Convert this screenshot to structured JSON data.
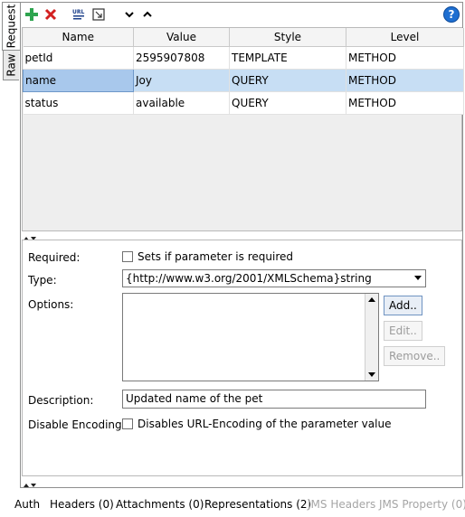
{
  "left_tabs": [
    {
      "label": "Request"
    },
    {
      "label": "Raw"
    }
  ],
  "toolbar": {
    "icons": [
      "add-icon",
      "delete-icon",
      "extract-url-params-icon",
      "fit-icon",
      "move-down-icon",
      "move-up-icon",
      "help-icon"
    ],
    "help_label": "?"
  },
  "table": {
    "headers": [
      "Name",
      "Value",
      "Style",
      "Level"
    ],
    "rows": [
      {
        "name": "petId",
        "value": "2595907808",
        "style": "TEMPLATE",
        "level": "METHOD",
        "selected": false
      },
      {
        "name": "name",
        "value": "Joy",
        "style": "QUERY",
        "level": "METHOD",
        "selected": true
      },
      {
        "name": "status",
        "value": "available",
        "style": "QUERY",
        "level": "METHOD",
        "selected": false
      }
    ]
  },
  "details": {
    "required_label": "Required:",
    "required_checkbox_label": "Sets if parameter is required",
    "type_label": "Type:",
    "type_value": "{http://www.w3.org/2001/XMLSchema}string",
    "options_label": "Options:",
    "add_button": "Add..",
    "edit_button": "Edit..",
    "remove_button": "Remove..",
    "description_label": "Description:",
    "description_value": "Updated name of the pet",
    "disable_encoding_label": "Disable Encoding:",
    "disable_encoding_checkbox_label": "Disables URL-Encoding of the parameter value"
  },
  "bottom_tabs": [
    {
      "label": "Auth",
      "enabled": true
    },
    {
      "label": "Headers (0)",
      "enabled": true
    },
    {
      "label": "Attachments (0)",
      "enabled": true
    },
    {
      "label": "Representations (2)",
      "enabled": true
    },
    {
      "label": "JMS Headers",
      "enabled": false
    },
    {
      "label": "JMS Property (0)",
      "enabled": false
    }
  ],
  "colors": {
    "selected_row": "#c7def4",
    "help_icon": "#1f6fd1",
    "add_icon": "#2ea44f",
    "delete_icon": "#d32020"
  }
}
